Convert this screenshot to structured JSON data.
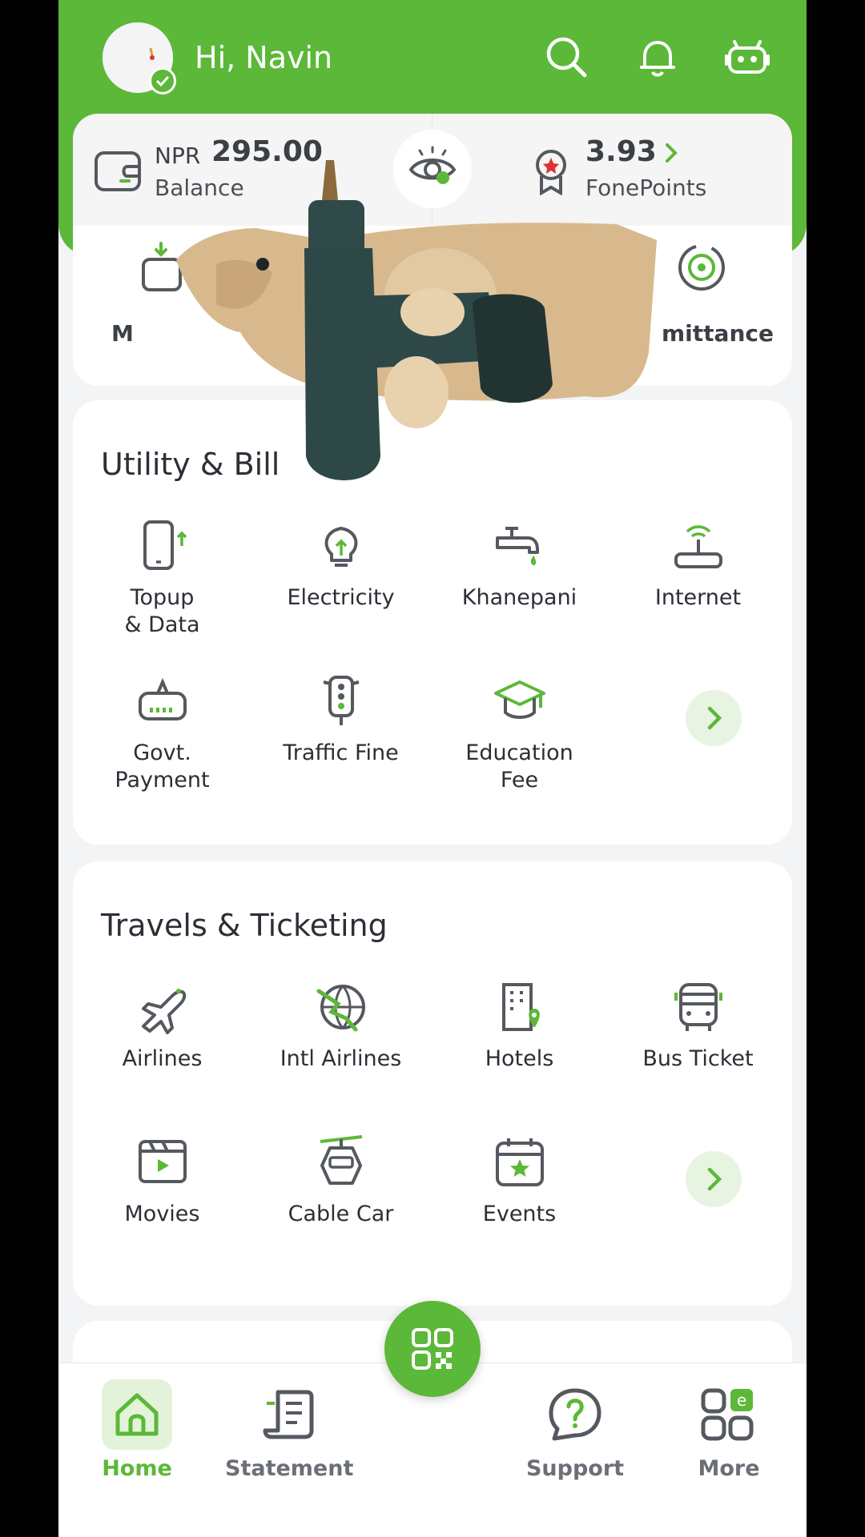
{
  "header": {
    "greeting": "Hi, Navin",
    "icons": [
      "search-icon",
      "bell-icon",
      "bot-icon"
    ]
  },
  "balance": {
    "currency": "NPR",
    "amount": "295.00",
    "label": "Balance",
    "fonepoints_value": "3.93",
    "fonepoints_label": "FonePoints"
  },
  "quick_actions": {
    "items": [
      {
        "label": "M",
        "icon": "load-money-icon"
      },
      {
        "label": "",
        "icon": "send-money-icon"
      },
      {
        "label": "",
        "icon": "bank-transfer-icon"
      },
      {
        "label": "mittance",
        "icon": "remittance-icon"
      }
    ]
  },
  "utility": {
    "title": "Utility & Bill",
    "items": [
      {
        "label": "Topup\n& Data",
        "icon": "phone-topup-icon"
      },
      {
        "label": "Electricity",
        "icon": "bulb-icon"
      },
      {
        "label": "Khanepani",
        "icon": "water-tap-icon"
      },
      {
        "label": "Internet",
        "icon": "router-icon"
      },
      {
        "label": "Govt.\nPayment",
        "icon": "govt-icon"
      },
      {
        "label": "Traffic Fine",
        "icon": "traffic-light-icon"
      },
      {
        "label": "Education\nFee",
        "icon": "graduation-cap-icon"
      }
    ]
  },
  "travel": {
    "title": "Travels & Ticketing",
    "items": [
      {
        "label": "Airlines",
        "icon": "plane-icon"
      },
      {
        "label": "Intl Airlines",
        "icon": "globe-plane-icon"
      },
      {
        "label": "Hotels",
        "icon": "hotel-icon"
      },
      {
        "label": "Bus Ticket",
        "icon": "bus-icon"
      },
      {
        "label": "Movies",
        "icon": "movie-icon"
      },
      {
        "label": "Cable Car",
        "icon": "cable-car-icon"
      },
      {
        "label": "Events",
        "icon": "calendar-star-icon"
      }
    ]
  },
  "bottom_nav": {
    "home": "Home",
    "statement": "Statement",
    "support": "Support",
    "more": "More"
  },
  "colors": {
    "brand_green": "#5cb838",
    "light_green": "#e8f4e2"
  }
}
